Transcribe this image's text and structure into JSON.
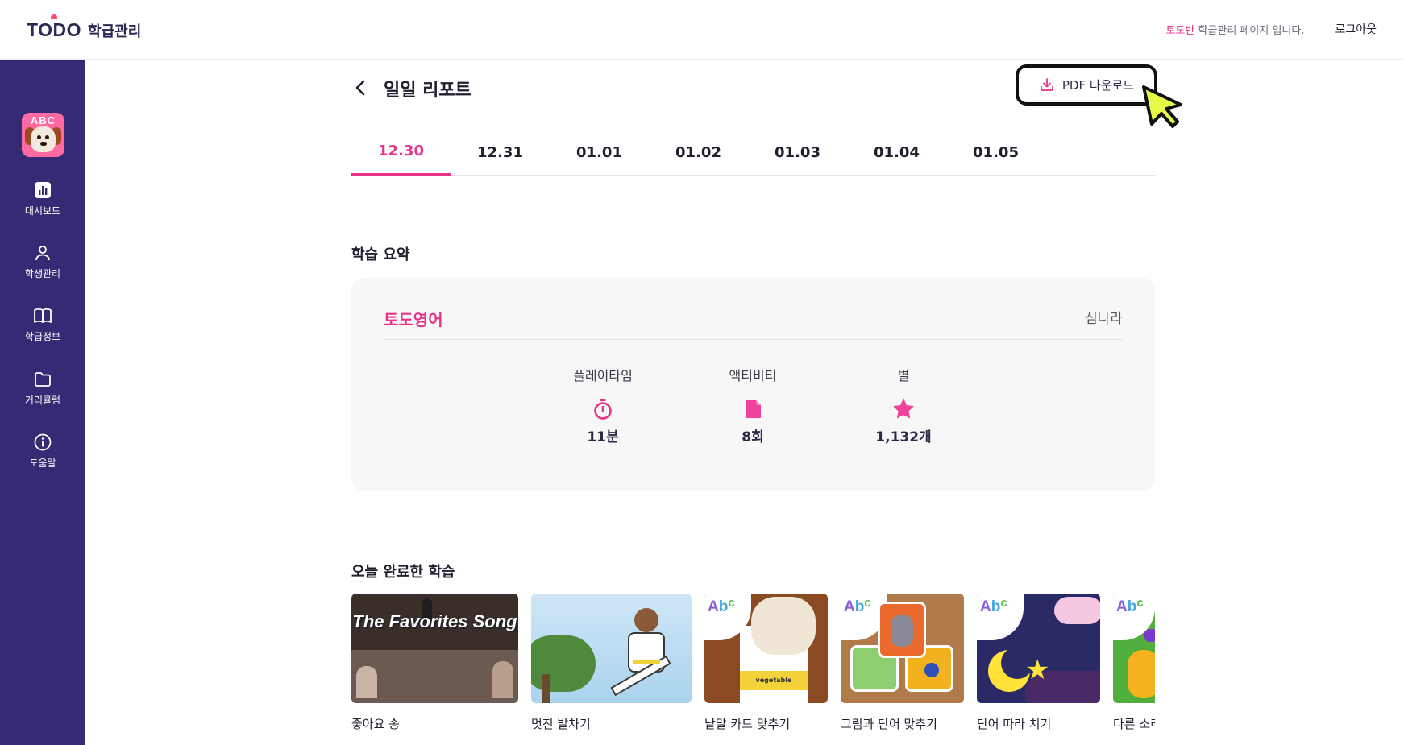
{
  "header": {
    "logo_mark": "TODO",
    "logo_text": "학급관리",
    "notice_class": "토도반",
    "notice_rest": " 학급관리 페이지 입니다.",
    "logout_label": "로그아웃"
  },
  "sidebar": {
    "avatar_text": "ABC",
    "items": [
      {
        "label": "대시보드",
        "icon": "bar-chart-icon"
      },
      {
        "label": "학생관리",
        "icon": "person-icon"
      },
      {
        "label": "학급정보",
        "icon": "book-icon"
      },
      {
        "label": "커리큘럼",
        "icon": "folder-icon"
      },
      {
        "label": "도움말",
        "icon": "info-icon"
      }
    ]
  },
  "page": {
    "title": "일일 리포트",
    "pdf_label": "PDF 다운로드"
  },
  "tabs": [
    "12.30",
    "12.31",
    "01.01",
    "01.02",
    "01.03",
    "01.04",
    "01.05"
  ],
  "active_tab": 0,
  "summary": {
    "section_title": "학습 요약",
    "course": "토도영어",
    "student": "심나라",
    "stats": [
      {
        "label": "플레이타임",
        "value": "11분",
        "icon": "stopwatch-icon"
      },
      {
        "label": "액티비티",
        "value": "8회",
        "icon": "card-icon"
      },
      {
        "label": "별",
        "value": "1,132개",
        "icon": "star-icon"
      }
    ]
  },
  "completed": {
    "section_title": "오늘 완료한 학습",
    "items": [
      {
        "caption": "좋아요 송",
        "image_text": "The Favorites Song"
      },
      {
        "caption": "멋진 발차기"
      },
      {
        "caption": "낱말 카드 맞추기",
        "image_text": "vegetable"
      },
      {
        "caption": "그림과 단어 맞추기"
      },
      {
        "caption": "단어 따라 치기"
      },
      {
        "caption": "다른 소리"
      }
    ]
  },
  "colors": {
    "accent_pink": "#e8338a",
    "sidebar_purple": "#372a75",
    "card_bg": "#f7f7f8"
  }
}
